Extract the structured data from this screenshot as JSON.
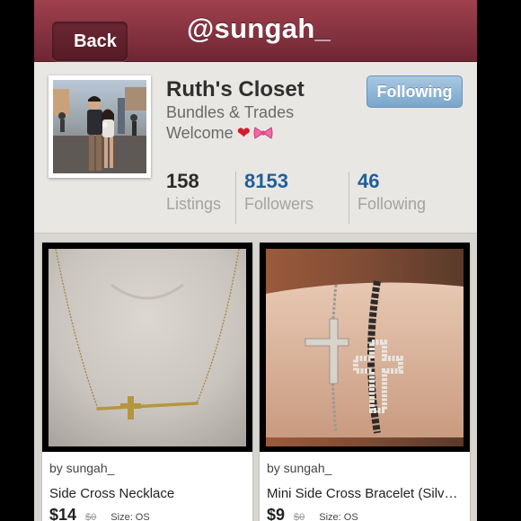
{
  "nav": {
    "back_label": "Back",
    "title": "@sungah_"
  },
  "profile": {
    "name": "Ruth's Closet",
    "bio_line1": "Bundles & Trades",
    "bio_line2": "Welcome",
    "bio_icons": [
      "heart-icon",
      "ribbon-bow-icon"
    ],
    "follow_button": "Following",
    "stats": [
      {
        "value": "158",
        "label": "Listings"
      },
      {
        "value": "8153",
        "label": "Followers"
      },
      {
        "value": "46",
        "label": "Following"
      }
    ]
  },
  "listings": [
    {
      "seller": "by sungah_",
      "title": "Side Cross Necklace",
      "price": "$14",
      "original_price": "$0",
      "size": "Size: OS"
    },
    {
      "seller": "by sungah_",
      "title": "Mini Side Cross Bracelet (Silv…",
      "price": "$9",
      "original_price": "$0",
      "size": "Size: OS"
    }
  ],
  "colors": {
    "nav_bar": "#853240",
    "follow_button": "#7aa6cd",
    "stat_number": "#1f5f9b",
    "primary_stat_number": "#2b2b2b",
    "heart": "#d21b2b"
  }
}
